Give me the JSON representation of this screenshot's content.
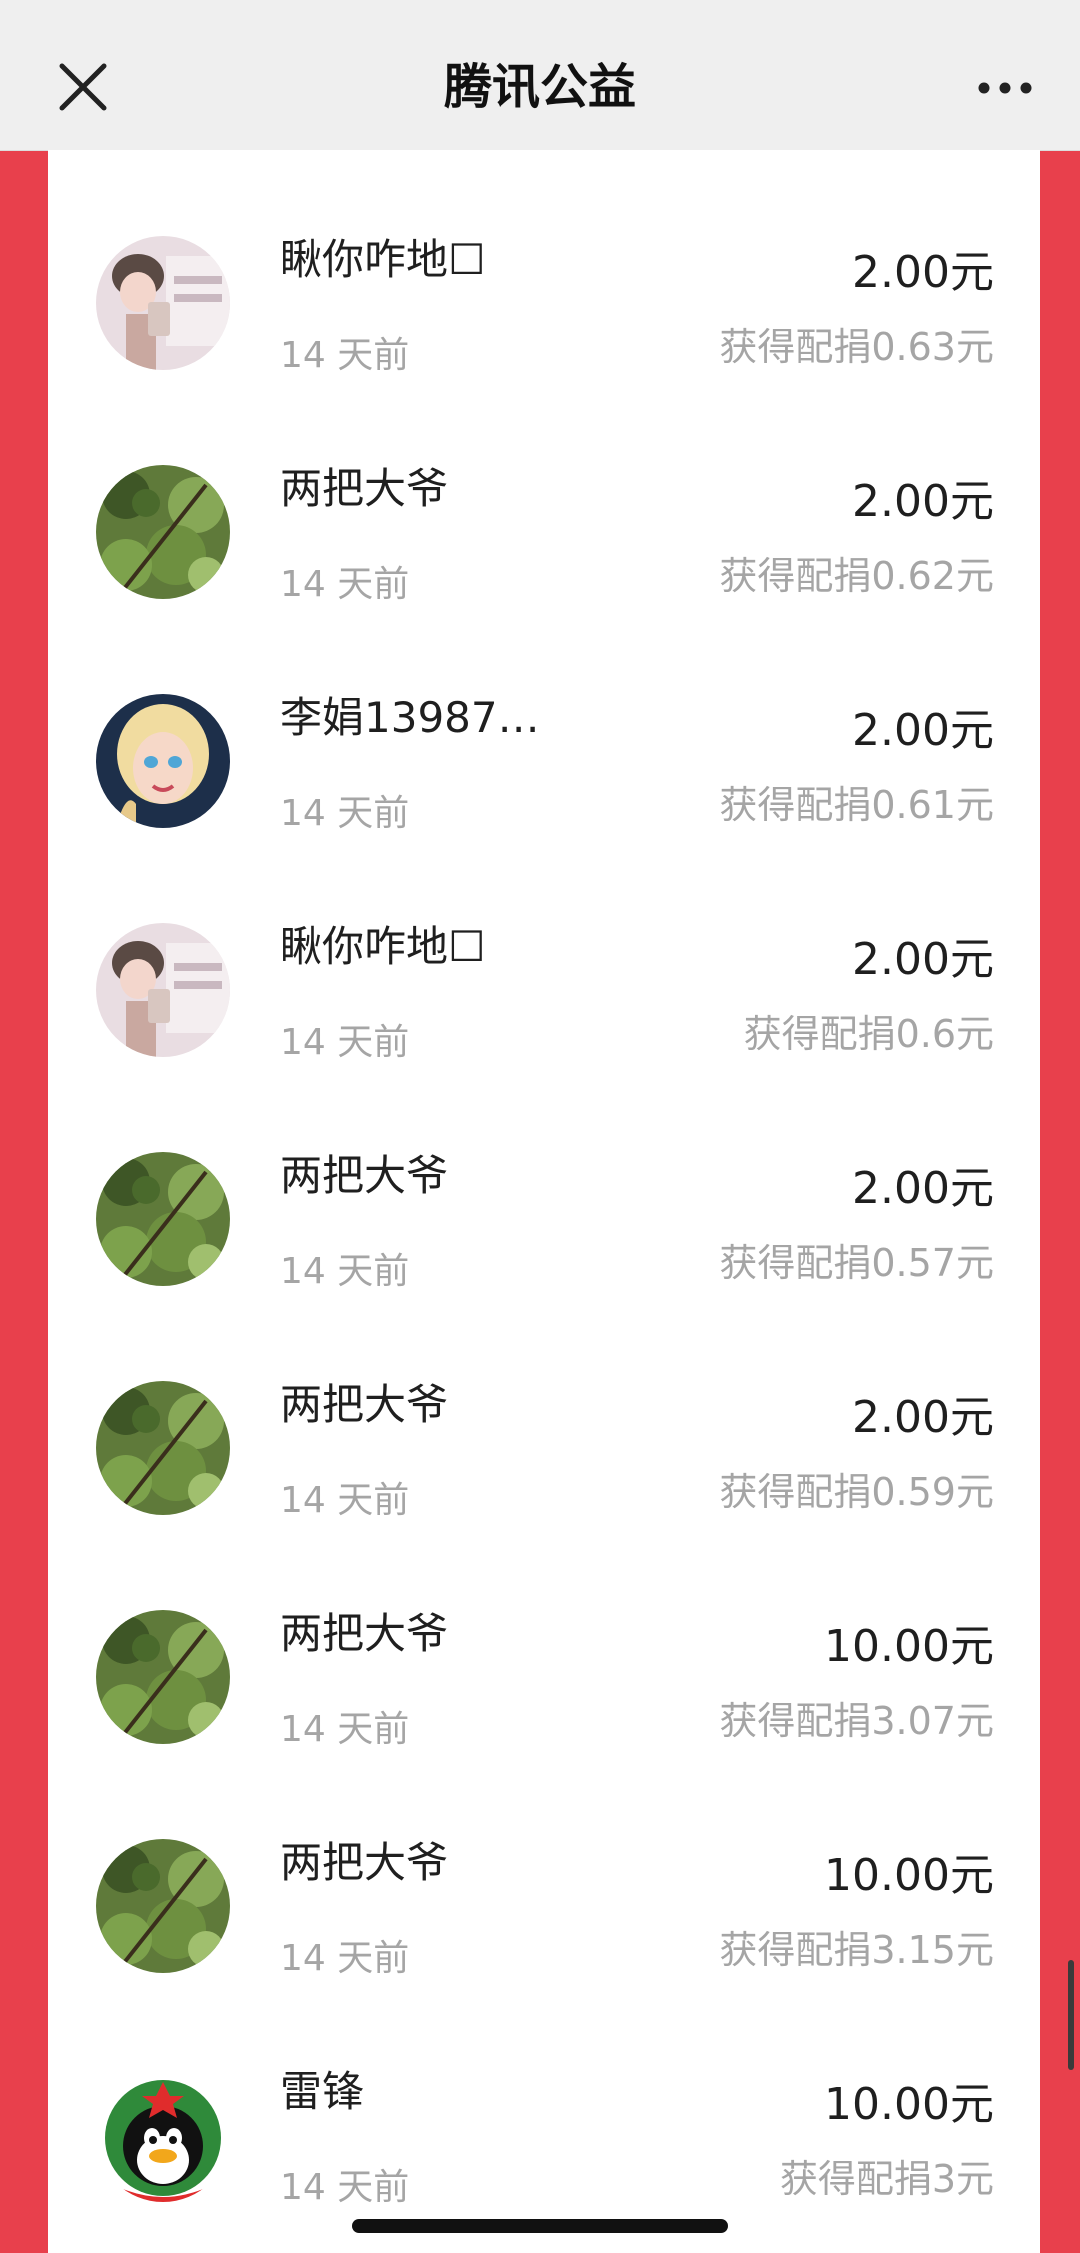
{
  "header": {
    "title": "腾讯公益",
    "close_icon": "close-icon",
    "more_icon": "more-icon"
  },
  "rows": [
    {
      "name": "瞅你咋地☐",
      "time": "14 天前",
      "amount": "2.00元",
      "match": "获得配捐0.63元",
      "avatar": "avatar-photo-girl"
    },
    {
      "name": "两把大爷",
      "time": "14 天前",
      "amount": "2.00元",
      "match": "获得配捐0.62元",
      "avatar": "avatar-green-plant"
    },
    {
      "name": "李娟13987…",
      "time": "14 天前",
      "amount": "2.00元",
      "match": "获得配捐0.61元",
      "avatar": "avatar-cartoon-princess"
    },
    {
      "name": "瞅你咋地☐",
      "time": "14 天前",
      "amount": "2.00元",
      "match": "获得配捐0.6元",
      "avatar": "avatar-photo-girl"
    },
    {
      "name": "两把大爷",
      "time": "14 天前",
      "amount": "2.00元",
      "match": "获得配捐0.57元",
      "avatar": "avatar-green-plant"
    },
    {
      "name": "两把大爷",
      "time": "14 天前",
      "amount": "2.00元",
      "match": "获得配捐0.59元",
      "avatar": "avatar-green-plant"
    },
    {
      "name": "两把大爷",
      "time": "14 天前",
      "amount": "10.00元",
      "match": "获得配捐3.07元",
      "avatar": "avatar-green-plant"
    },
    {
      "name": "两把大爷",
      "time": "14 天前",
      "amount": "10.00元",
      "match": "获得配捐3.15元",
      "avatar": "avatar-green-plant"
    },
    {
      "name": "雷锋",
      "time": "14 天前",
      "amount": "10.00元",
      "match": "获得配捐3元",
      "avatar": "avatar-qq-penguin"
    }
  ],
  "colors": {
    "background_red": "#e8404c",
    "card": "#ffffff",
    "text_primary": "#1f1f1f",
    "text_secondary": "#a5a5a5"
  }
}
